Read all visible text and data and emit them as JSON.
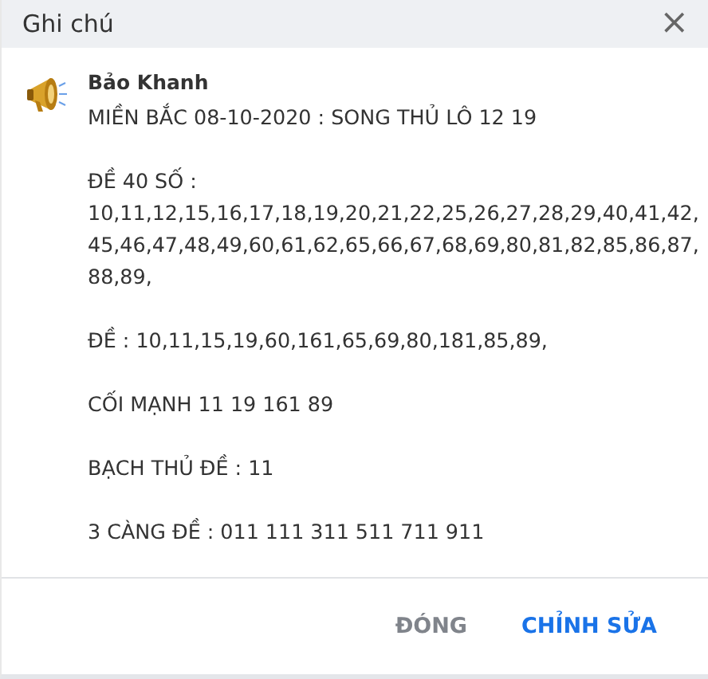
{
  "dialog": {
    "title": "Ghi chú",
    "close": "×"
  },
  "note": {
    "author": "Bảo Khanh",
    "paragraphs": [
      "MIỀN BẮC 08-10-2020 : SONG THỦ LÔ 12 19",
      "ĐỀ 40 SỐ :\n10,11,12,15,16,17,18,19,20,21,22,25,26,27,28,29,40,41,42,\n45,46,47,48,49,60,61,62,65,66,67,68,69,80,81,82,85,86,87,\n88,89,",
      "ĐỀ : 10,11,15,19,60,161,65,69,80,181,85,89,",
      "CỐI MẠNH 11 19 161 89",
      "BẠCH THỦ ĐỀ : 11",
      "3 CÀNG ĐỀ : 011 111 311 511 711 911"
    ]
  },
  "buttons": [
    {
      "label": "ĐÓNG",
      "kind": "secondary"
    },
    {
      "label": "CHỈNH SỬA",
      "kind": "primary"
    }
  ]
}
